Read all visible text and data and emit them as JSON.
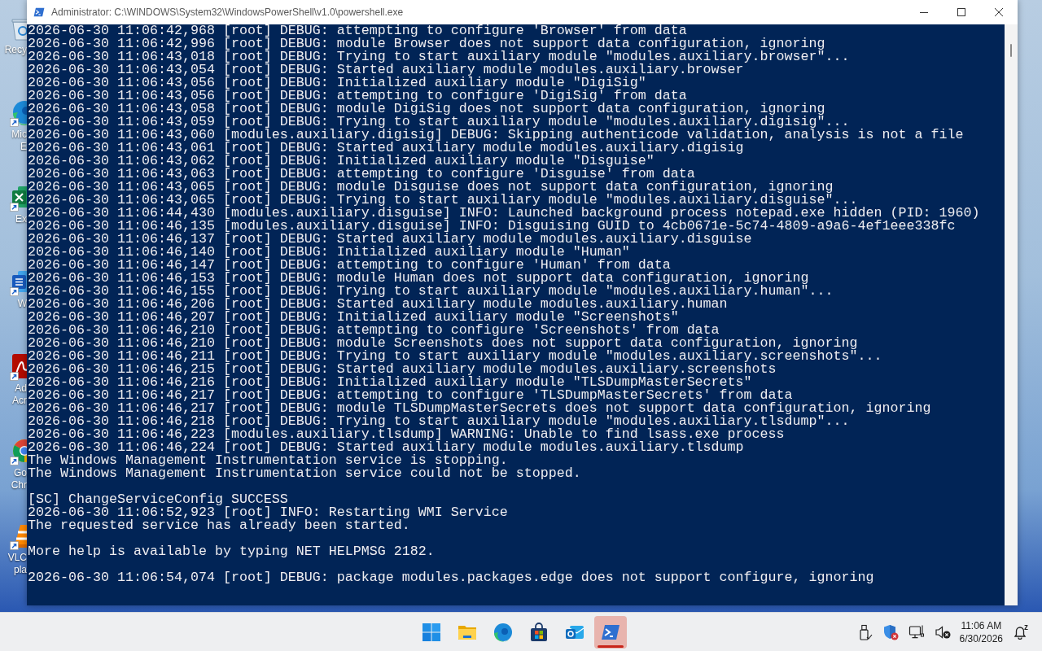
{
  "desktop": {
    "icons": [
      {
        "kind": "bin",
        "label": "Recy",
        "shortcut": false
      },
      {
        "kind": "edge",
        "label": "Mic\nE",
        "shortcut": true
      },
      {
        "kind": "excel",
        "label": "Ex",
        "shortcut": true
      },
      {
        "kind": "word",
        "label": "W",
        "shortcut": true
      },
      {
        "kind": "acrobat",
        "label": "Ad\nAcr",
        "shortcut": true
      },
      {
        "kind": "chrome",
        "label": "Go\nChr",
        "shortcut": true
      },
      {
        "kind": "vlc",
        "label": "VLC\npla",
        "shortcut": true
      }
    ]
  },
  "window": {
    "title": "Administrator: C:\\WINDOWS\\System32\\WindowsPowerShell\\v1.0\\powershell.exe",
    "console": {
      "blocks": [
        {
          "lines": [
            "2026-06-30 11:06:42,968 [root] DEBUG: attempting to configure 'Browser' from data",
            "2026-06-30 11:06:42,996 [root] DEBUG: module Browser does not support data configuration, ignoring",
            "2026-06-30 11:06:43,018 [root] DEBUG: Trying to start auxiliary module \"modules.auxiliary.browser\"...",
            "2026-06-30 11:06:43,054 [root] DEBUG: Started auxiliary module modules.auxiliary.browser",
            "2026-06-30 11:06:43,056 [root] DEBUG: Initialized auxiliary module \"DigiSig\"",
            "2026-06-30 11:06:43,056 [root] DEBUG: attempting to configure 'DigiSig' from data",
            "2026-06-30 11:06:43,058 [root] DEBUG: module DigiSig does not support data configuration, ignoring",
            "2026-06-30 11:06:43,059 [root] DEBUG: Trying to start auxiliary module \"modules.auxiliary.digisig\"...",
            "2026-06-30 11:06:43,060 [modules.auxiliary.digisig] DEBUG: Skipping authenticode validation, analysis is not a file",
            "2026-06-30 11:06:43,061 [root] DEBUG: Started auxiliary module modules.auxiliary.digisig",
            "2026-06-30 11:06:43,062 [root] DEBUG: Initialized auxiliary module \"Disguise\"",
            "2026-06-30 11:06:43,063 [root] DEBUG: attempting to configure 'Disguise' from data",
            "2026-06-30 11:06:43,065 [root] DEBUG: module Disguise does not support data configuration, ignoring",
            "2026-06-30 11:06:43,065 [root] DEBUG: Trying to start auxiliary module \"modules.auxiliary.disguise\"...",
            "2026-06-30 11:06:44,430 [modules.auxiliary.disguise] INFO: Launched background process notepad.exe hidden (PID: 1960)",
            "2026-06-30 11:06:46,135 [modules.auxiliary.disguise] INFO: Disguising GUID to 4cb0671e-5c74-4809-a9a6-4ef1eee338fc",
            "2026-06-30 11:06:46,137 [root] DEBUG: Started auxiliary module modules.auxiliary.disguise",
            "2026-06-30 11:06:46,140 [root] DEBUG: Initialized auxiliary module \"Human\"",
            "2026-06-30 11:06:46,147 [root] DEBUG: attempting to configure 'Human' from data",
            "2026-06-30 11:06:46,153 [root] DEBUG: module Human does not support data configuration, ignoring",
            "2026-06-30 11:06:46,155 [root] DEBUG: Trying to start auxiliary module \"modules.auxiliary.human\"...",
            "2026-06-30 11:06:46,206 [root] DEBUG: Started auxiliary module modules.auxiliary.human",
            "2026-06-30 11:06:46,207 [root] DEBUG: Initialized auxiliary module \"Screenshots\"",
            "2026-06-30 11:06:46,210 [root] DEBUG: attempting to configure 'Screenshots' from data",
            "2026-06-30 11:06:46,210 [root] DEBUG: module Screenshots does not support data configuration, ignoring",
            "2026-06-30 11:06:46,211 [root] DEBUG: Trying to start auxiliary module \"modules.auxiliary.screenshots\"...",
            "2026-06-30 11:06:46,215 [root] DEBUG: Started auxiliary module modules.auxiliary.screenshots",
            "2026-06-30 11:06:46,216 [root] DEBUG: Initialized auxiliary module \"TLSDumpMasterSecrets\"",
            "2026-06-30 11:06:46,217 [root] DEBUG: attempting to configure 'TLSDumpMasterSecrets' from data",
            "2026-06-30 11:06:46,217 [root] DEBUG: module TLSDumpMasterSecrets does not support data configuration, ignoring",
            "2026-06-30 11:06:46,218 [root] DEBUG: Trying to start auxiliary module \"modules.auxiliary.tlsdump\"...",
            "2026-06-30 11:06:46,223 [modules.auxiliary.tlsdump] WARNING: Unable to find lsass.exe process",
            "2026-06-30 11:06:46,224 [root] DEBUG: Started auxiliary module modules.auxiliary.tlsdump",
            "The Windows Management Instrumentation service is stopping.",
            "The Windows Management Instrumentation service could not be stopped."
          ]
        },
        {
          "lines": [
            "[SC] ChangeServiceConfig SUCCESS",
            "2026-06-30 11:06:52,923 [root] INFO: Restarting WMI Service",
            "The requested service has already been started."
          ]
        },
        {
          "lines": [
            "More help is available by typing NET HELPMSG 2182."
          ]
        },
        {
          "lines": [
            "2026-06-30 11:06:54,074 [root] DEBUG: package modules.packages.edge does not support configure, ignoring"
          ]
        }
      ]
    }
  },
  "taskbar": {
    "apps": [
      {
        "kind": "start",
        "selected": false
      },
      {
        "kind": "folder",
        "selected": false
      },
      {
        "kind": "edge",
        "selected": false
      },
      {
        "kind": "store",
        "selected": false
      },
      {
        "kind": "mail",
        "selected": false
      },
      {
        "kind": "terminal",
        "selected": true
      }
    ],
    "tray": {
      "icons": [
        {
          "kind": "usb",
          "alert": false
        },
        {
          "kind": "shield",
          "alert": true
        },
        {
          "kind": "network",
          "alert": false
        },
        {
          "kind": "speaker",
          "alert": false,
          "muted": true
        }
      ],
      "clock": {
        "time": "11:06 AM",
        "date": "6/30/2026"
      },
      "notifications": {
        "snooze_mark": "z"
      }
    }
  }
}
